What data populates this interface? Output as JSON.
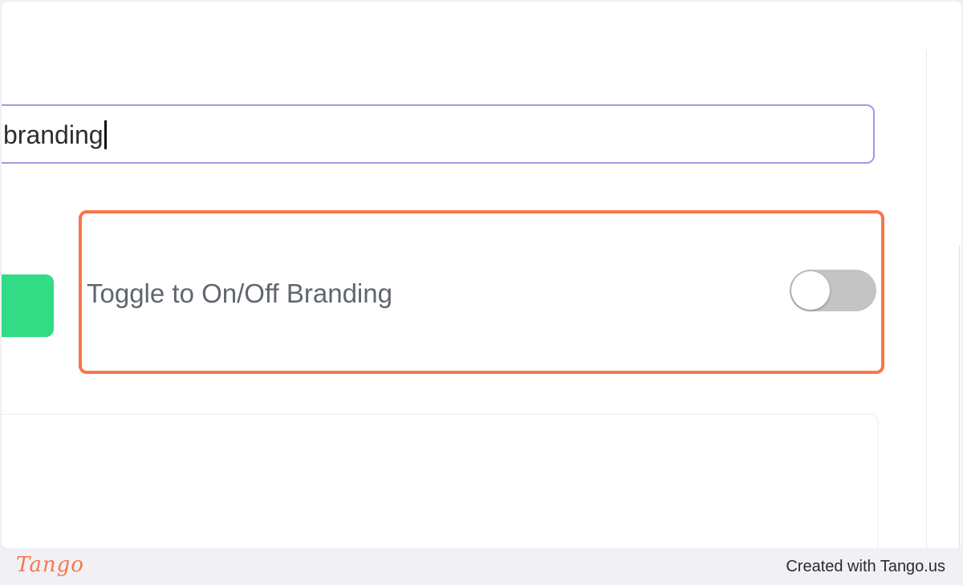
{
  "input": {
    "value": "branding"
  },
  "toggle_row": {
    "label": "Toggle to On/Off Branding",
    "state": "off"
  },
  "footer": {
    "logo": "Tango",
    "credit": "Created with Tango.us"
  },
  "colors": {
    "highlight": "#f6774a",
    "input_border": "#9c9be6",
    "green_button": "#31dc84",
    "toggle_track_off": "#c4c4c4"
  }
}
